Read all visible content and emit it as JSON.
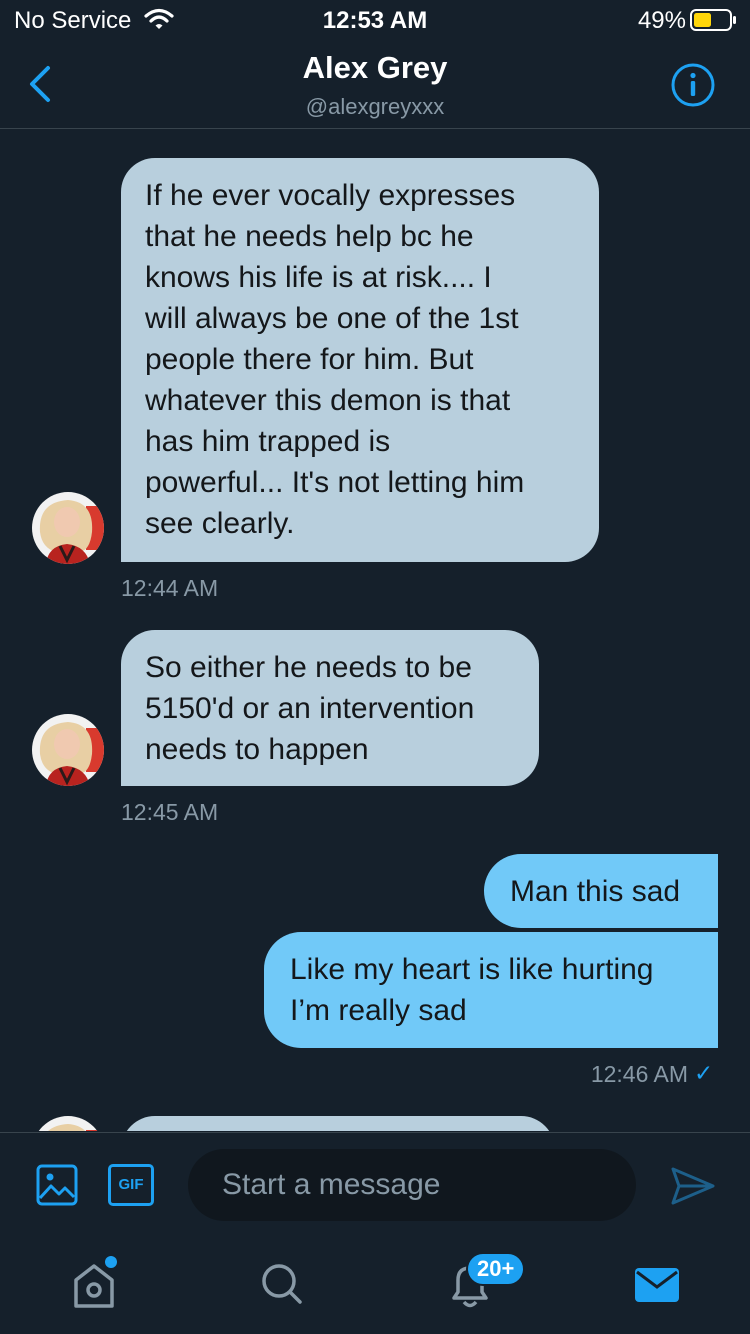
{
  "status_bar": {
    "carrier": "No Service",
    "time": "12:53 AM",
    "battery": "49%"
  },
  "header": {
    "name": "Alex Grey",
    "handle": "@alexgreyxxx"
  },
  "messages": [
    {
      "direction": "incoming",
      "lines": [
        "If he ever vocally expresses",
        "that he needs help bc he",
        "knows his life is at risk.... I",
        "will always be one of the 1st",
        "people there for him. But",
        "whatever this demon is that",
        "has him trapped is",
        "powerful... It's not letting him",
        "see clearly."
      ],
      "time": "12:44 AM"
    },
    {
      "direction": "incoming",
      "lines": [
        "So either he needs to be",
        "5150'd or an intervention",
        "needs to happen"
      ],
      "time": "12:45 AM"
    },
    {
      "direction": "outgoing",
      "lines": [
        "Man this sad"
      ]
    },
    {
      "direction": "outgoing",
      "lines": [
        "Like my heart is like hurting",
        "I’m really sad"
      ],
      "time": "12:46 AM",
      "read_receipt": "✓"
    }
  ],
  "composer": {
    "gif_label": "GIF",
    "placeholder": "Start a message"
  },
  "tab_bar": {
    "notifications_badge": "20+",
    "icons": [
      "home-icon",
      "search-icon",
      "bell-icon",
      "mail-icon"
    ]
  },
  "colors": {
    "background": "#15202b",
    "accent": "#1da1f2",
    "incoming_bubble": "#b8cfdd",
    "outgoing_bubble": "#71c9f8"
  }
}
